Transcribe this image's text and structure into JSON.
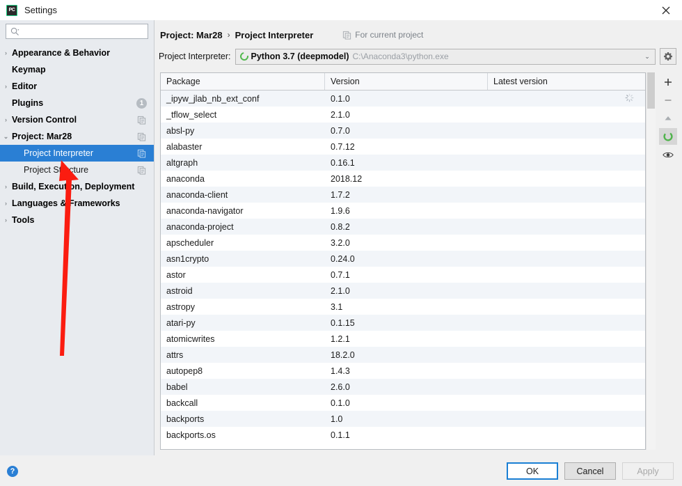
{
  "window": {
    "app_icon": "pycharm-icon",
    "title": "Settings",
    "close_label": "close-icon"
  },
  "sidebar": {
    "search": {
      "value": "",
      "placeholder": "",
      "icon": "search-icon"
    },
    "items": [
      {
        "label": "Appearance & Behavior",
        "arrow": "›",
        "level": 0,
        "selected": false,
        "badge": null,
        "copy": false
      },
      {
        "label": "Keymap",
        "arrow": "",
        "level": 0,
        "selected": false,
        "badge": null,
        "copy": false
      },
      {
        "label": "Editor",
        "arrow": "›",
        "level": 0,
        "selected": false,
        "badge": null,
        "copy": false
      },
      {
        "label": "Plugins",
        "arrow": "",
        "level": 0,
        "selected": false,
        "badge": "1",
        "copy": false
      },
      {
        "label": "Version Control",
        "arrow": "›",
        "level": 0,
        "selected": false,
        "badge": null,
        "copy": true
      },
      {
        "label": "Project: Mar28",
        "arrow": "⌄",
        "level": 0,
        "selected": false,
        "badge": null,
        "copy": true
      },
      {
        "label": "Project Interpreter",
        "arrow": "",
        "level": 1,
        "selected": true,
        "badge": null,
        "copy": true
      },
      {
        "label": "Project Structure",
        "arrow": "",
        "level": 1,
        "selected": false,
        "badge": null,
        "copy": true
      },
      {
        "label": "Build, Execution, Deployment",
        "arrow": "›",
        "level": 0,
        "selected": false,
        "badge": null,
        "copy": false
      },
      {
        "label": "Languages & Frameworks",
        "arrow": "›",
        "level": 0,
        "selected": false,
        "badge": null,
        "copy": false
      },
      {
        "label": "Tools",
        "arrow": "›",
        "level": 0,
        "selected": false,
        "badge": null,
        "copy": false
      }
    ]
  },
  "main": {
    "breadcrumb": {
      "parent": "Project: Mar28",
      "separator": "›",
      "current": "Project Interpreter"
    },
    "scope_note": {
      "icon": "copy-icon",
      "label": "For current project"
    },
    "interpreter": {
      "label": "Project Interpreter:",
      "env_icon": "conda-env-icon",
      "name": "Python 3.7 (deepmodel)",
      "path": "C:\\Anaconda3\\python.exe",
      "caret": "⌄",
      "settings_button": "gear-icon"
    },
    "table": {
      "columns": [
        "Package",
        "Version",
        "Latest version"
      ],
      "rows": [
        {
          "package": "_ipyw_jlab_nb_ext_conf",
          "version": "0.1.0",
          "latest": ""
        },
        {
          "package": "_tflow_select",
          "version": "2.1.0",
          "latest": ""
        },
        {
          "package": "absl-py",
          "version": "0.7.0",
          "latest": ""
        },
        {
          "package": "alabaster",
          "version": "0.7.12",
          "latest": ""
        },
        {
          "package": "altgraph",
          "version": "0.16.1",
          "latest": ""
        },
        {
          "package": "anaconda",
          "version": "2018.12",
          "latest": ""
        },
        {
          "package": "anaconda-client",
          "version": "1.7.2",
          "latest": ""
        },
        {
          "package": "anaconda-navigator",
          "version": "1.9.6",
          "latest": ""
        },
        {
          "package": "anaconda-project",
          "version": "0.8.2",
          "latest": ""
        },
        {
          "package": "apscheduler",
          "version": "3.2.0",
          "latest": ""
        },
        {
          "package": "asn1crypto",
          "version": "0.24.0",
          "latest": ""
        },
        {
          "package": "astor",
          "version": "0.7.1",
          "latest": ""
        },
        {
          "package": "astroid",
          "version": "2.1.0",
          "latest": ""
        },
        {
          "package": "astropy",
          "version": "3.1",
          "latest": ""
        },
        {
          "package": "atari-py",
          "version": "0.1.15",
          "latest": ""
        },
        {
          "package": "atomicwrites",
          "version": "1.2.1",
          "latest": ""
        },
        {
          "package": "attrs",
          "version": "18.2.0",
          "latest": ""
        },
        {
          "package": "autopep8",
          "version": "1.4.3",
          "latest": ""
        },
        {
          "package": "babel",
          "version": "2.6.0",
          "latest": ""
        },
        {
          "package": "backcall",
          "version": "0.1.0",
          "latest": ""
        },
        {
          "package": "backports",
          "version": "1.0",
          "latest": ""
        },
        {
          "package": "backports.os",
          "version": "0.1.1",
          "latest": ""
        }
      ],
      "loading_indicator": "loading-spinner-icon"
    },
    "toolbar": [
      {
        "name": "add-package-button",
        "glyph": "+"
      },
      {
        "name": "remove-package-button",
        "glyph": "−"
      },
      {
        "name": "upgrade-package-button",
        "glyph": "▲"
      },
      {
        "name": "conda-env-button",
        "glyph": ""
      },
      {
        "name": "show-early-releases-button",
        "glyph": ""
      }
    ]
  },
  "footer": {
    "help": "?",
    "ok_label": "OK",
    "cancel_label": "Cancel",
    "apply_label": "Apply"
  },
  "annotation": {
    "type": "red-arrow",
    "color": "#fb1c10",
    "points_to": "Project Interpreter"
  }
}
